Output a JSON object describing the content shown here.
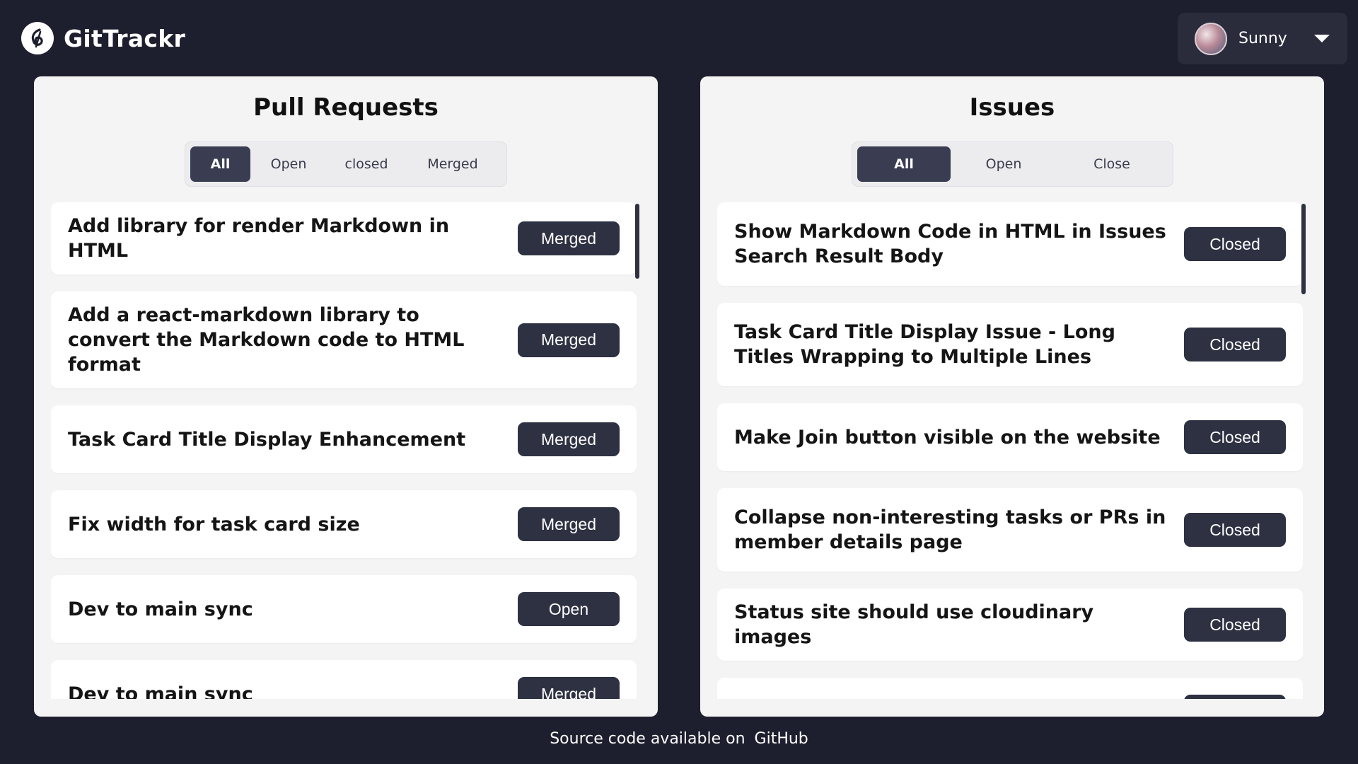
{
  "header": {
    "app_name": "GitTrackr",
    "user": {
      "name": "Sunny"
    }
  },
  "pull_requests": {
    "title": "Pull Requests",
    "tabs": [
      {
        "label": "All",
        "active": true
      },
      {
        "label": "Open",
        "active": false
      },
      {
        "label": "closed",
        "active": false
      },
      {
        "label": "Merged",
        "active": false
      }
    ],
    "items": [
      {
        "title": "Add library for render Markdown in HTML",
        "status": "Merged"
      },
      {
        "title": "Add a react-markdown library to convert the Markdown code to HTML format",
        "status": "Merged"
      },
      {
        "title": "Task Card Title Display Enhancement",
        "status": "Merged"
      },
      {
        "title": "Fix width for task card size",
        "status": "Merged"
      },
      {
        "title": "Dev to main sync",
        "status": "Open"
      },
      {
        "title": "Dev to main sync",
        "status": "Merged"
      }
    ]
  },
  "issues": {
    "title": "Issues",
    "tabs": [
      {
        "label": "All",
        "active": true
      },
      {
        "label": "Open",
        "active": false
      },
      {
        "label": "Close",
        "active": false
      }
    ],
    "items": [
      {
        "title": "Show Markdown Code in HTML in Issues Search Result Body",
        "status": "Closed"
      },
      {
        "title": "Task Card Title Display Issue - Long Titles Wrapping to Multiple Lines",
        "status": "Closed"
      },
      {
        "title": "Make Join button visible on the website",
        "status": "Closed"
      },
      {
        "title": "Collapse non-interesting tasks or PRs in member details page",
        "status": "Closed"
      },
      {
        "title": "Status site should use cloudinary images",
        "status": "Closed"
      }
    ]
  },
  "footer": {
    "text": "Source code available on",
    "link_label": "GitHub"
  },
  "colors": {
    "background": "#1e1f2e",
    "panel": "#f4f4f5",
    "badge": "#2d3142",
    "active_tab": "#3a3d52"
  }
}
